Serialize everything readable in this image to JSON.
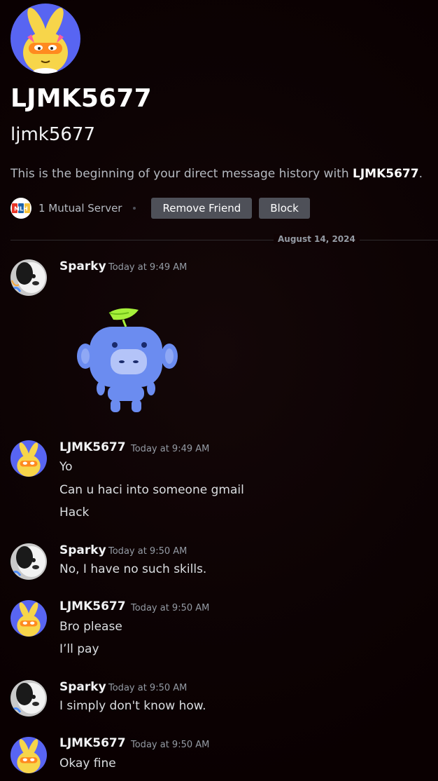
{
  "profile": {
    "display_name": "LJMK5677",
    "username": "ljmk5677",
    "intro_prefix": "This is the beginning of your direct message history with ",
    "intro_name": "LJMK5677",
    "intro_suffix": ".",
    "mutual_servers": "1 Mutual Server",
    "server_badge_text": "MLH",
    "remove_friend_label": "Remove Friend",
    "block_label": "Block"
  },
  "date_divider": "August 14, 2024",
  "messages": [
    {
      "author": "Sparky",
      "time": "Today at 9:49 AM",
      "avatar": "dog-avatar",
      "lines": [],
      "sticker": "wumpus-leaf-sticker"
    },
    {
      "author": "LJMK5677",
      "time": "Today at 9:49 AM",
      "avatar": "bunny-avatar",
      "lines": [
        "Yo",
        "Can u haci into someone gmail",
        "Hack"
      ]
    },
    {
      "author": "Sparky",
      "time": "Today at 9:50 AM",
      "avatar": "dog-avatar",
      "lines": [
        "No, I have no such skills."
      ]
    },
    {
      "author": "LJMK5677",
      "time": "Today at 9:50 AM",
      "avatar": "bunny-avatar",
      "lines": [
        "Bro please",
        "I’ll pay"
      ]
    },
    {
      "author": "Sparky",
      "time": "Today at 9:50 AM",
      "avatar": "dog-avatar",
      "lines": [
        "I simply don't know how."
      ]
    },
    {
      "author": "LJMK5677",
      "time": "Today at 9:50 AM",
      "avatar": "bunny-avatar",
      "lines": [
        "Okay fine"
      ]
    }
  ],
  "colors": {
    "background": "#0d0304",
    "button": "#4e5058",
    "text_muted": "#949ba4",
    "bunny_bg": "#5865f2",
    "wumpus": "#6b8cf0",
    "leaf": "#a6f03a"
  }
}
